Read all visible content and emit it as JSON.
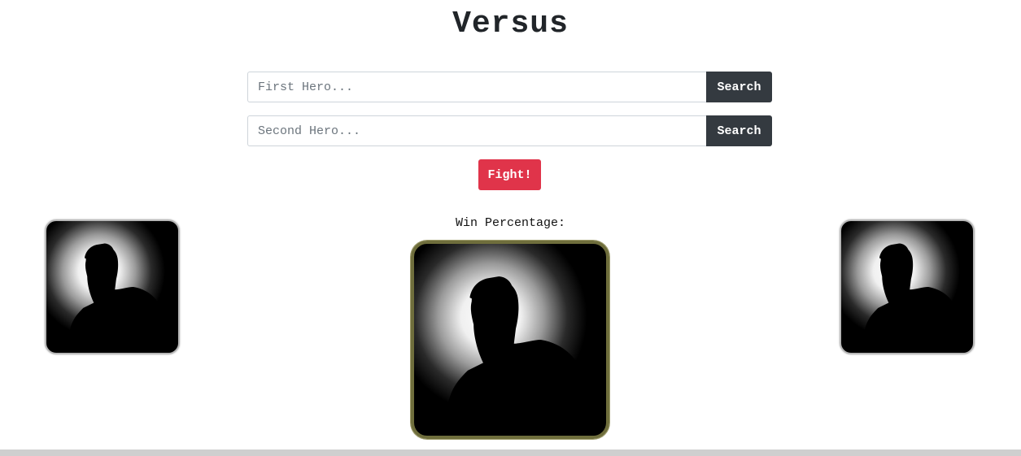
{
  "header": {
    "title": "Versus"
  },
  "search": {
    "first": {
      "placeholder": "First Hero...",
      "value": "",
      "button_label": "Search"
    },
    "second": {
      "placeholder": "Second Hero...",
      "value": "",
      "button_label": "Search"
    }
  },
  "fight": {
    "label": "Fight!"
  },
  "result": {
    "win_percentage_label": "Win Percentage:"
  },
  "heroes": {
    "left": {
      "icon": "silhouette-avatar-icon"
    },
    "center": {
      "icon": "silhouette-avatar-icon"
    },
    "right": {
      "icon": "silhouette-avatar-icon"
    }
  },
  "colors": {
    "search_button": "#343a40",
    "fight_button": "#e0344a",
    "center_frame_border": "#6f6e3c",
    "side_frame_border": "#b8b8b8"
  }
}
